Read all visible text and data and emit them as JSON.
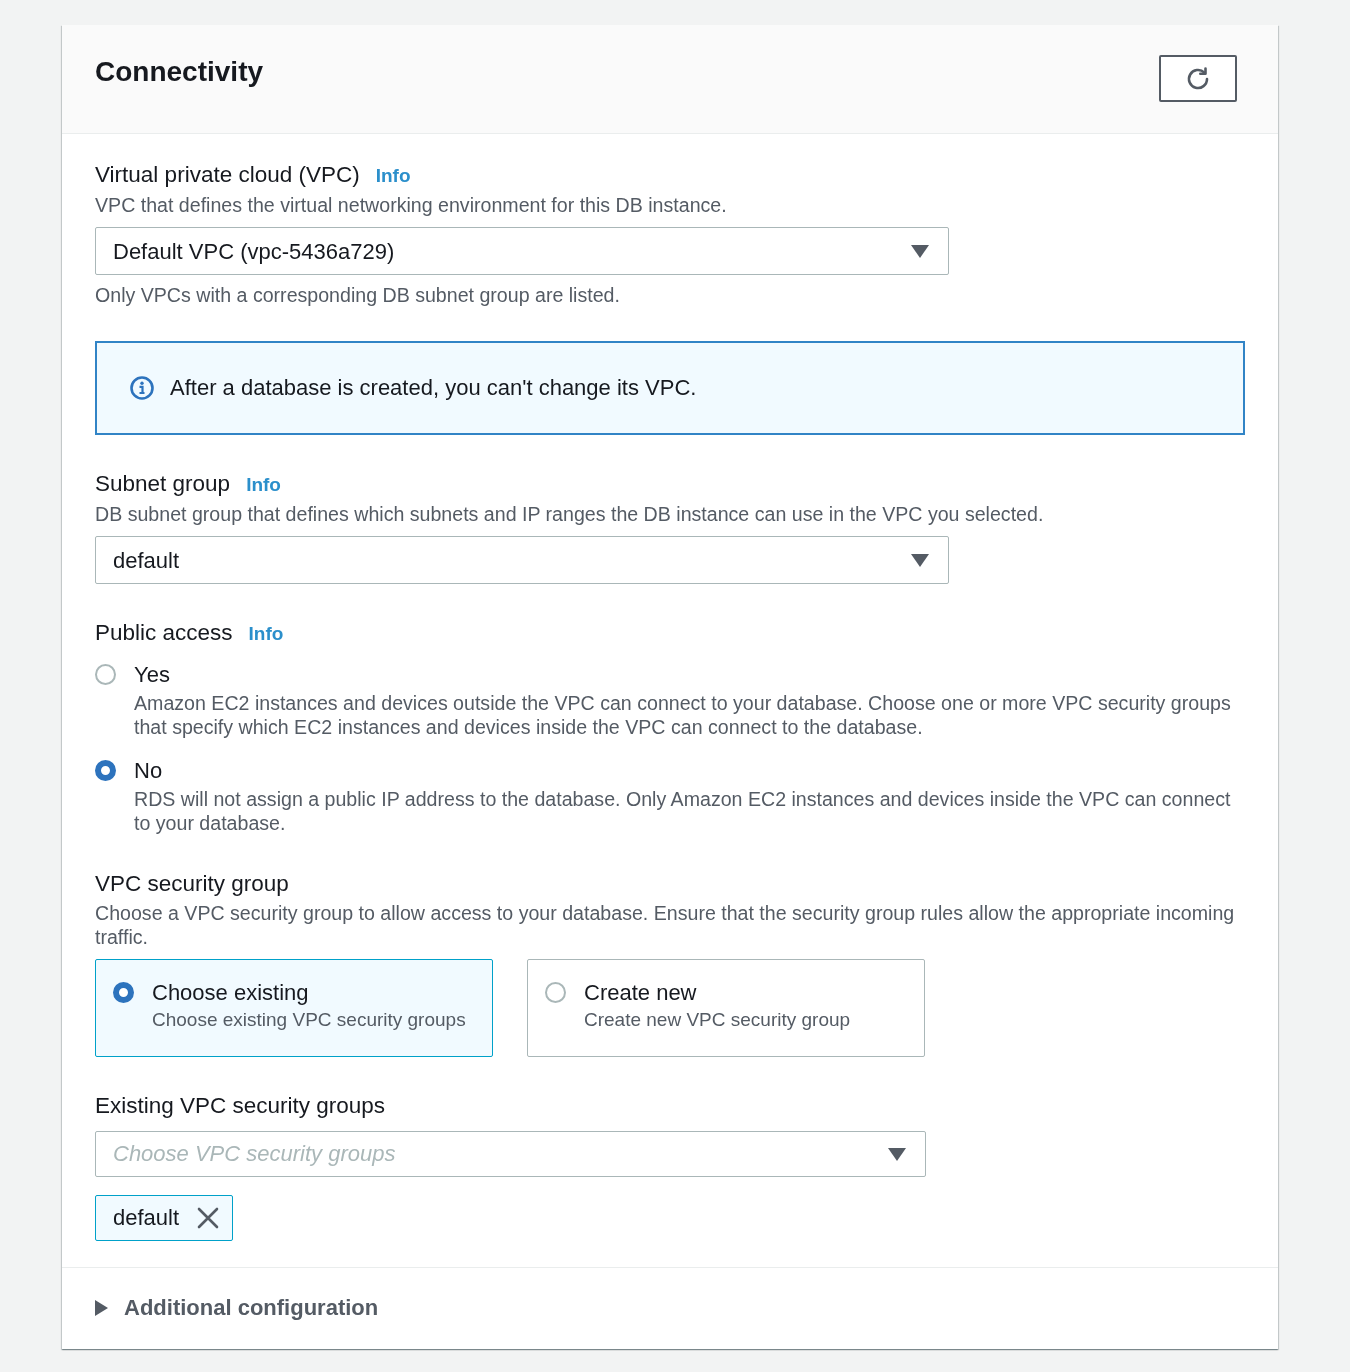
{
  "panel": {
    "title": "Connectivity"
  },
  "sections": [
    {
      "kind": "select",
      "label": "Virtual private cloud (VPC)",
      "info": "Info",
      "description": "VPC that defines the virtual networking environment for this DB instance.",
      "value": "Default VPC (vpc-5436a729)",
      "hint": "Only VPCs with a corresponding DB subnet group are listed."
    },
    {
      "kind": "alert",
      "text": "After a database is created, you can't change its VPC."
    },
    {
      "kind": "select",
      "label": "Subnet group",
      "info": "Info",
      "description": "DB subnet group that defines which subnets and IP ranges the DB instance can use in the VPC you selected.",
      "value": "default"
    },
    {
      "kind": "radio_group",
      "label": "Public access",
      "info": "Info",
      "options": [
        {
          "label": "Yes",
          "description": "Amazon EC2 instances and devices outside the VPC can connect to your database. Choose one or more VPC security groups that specify which EC2 instances and devices inside the VPC can connect to the database.",
          "selected": false
        },
        {
          "label": "No",
          "description": "RDS will not assign a public IP address to the database. Only Amazon EC2 instances and devices inside the VPC can connect to your database.",
          "selected": true
        }
      ]
    },
    {
      "kind": "tiles",
      "label": "VPC security group",
      "description": "Choose a VPC security group to allow access to your database. Ensure that the security group rules allow the appropriate incoming traffic.",
      "options": [
        {
          "label": "Choose existing",
          "description": "Choose existing VPC security groups",
          "selected": true
        },
        {
          "label": "Create new",
          "description": "Create new VPC security group",
          "selected": false
        }
      ]
    },
    {
      "kind": "multiselect",
      "label": "Existing VPC security groups",
      "placeholder": "Choose VPC security groups",
      "tokens": [
        "default"
      ]
    }
  ],
  "expander": {
    "label": "Additional configuration",
    "expanded": false
  }
}
